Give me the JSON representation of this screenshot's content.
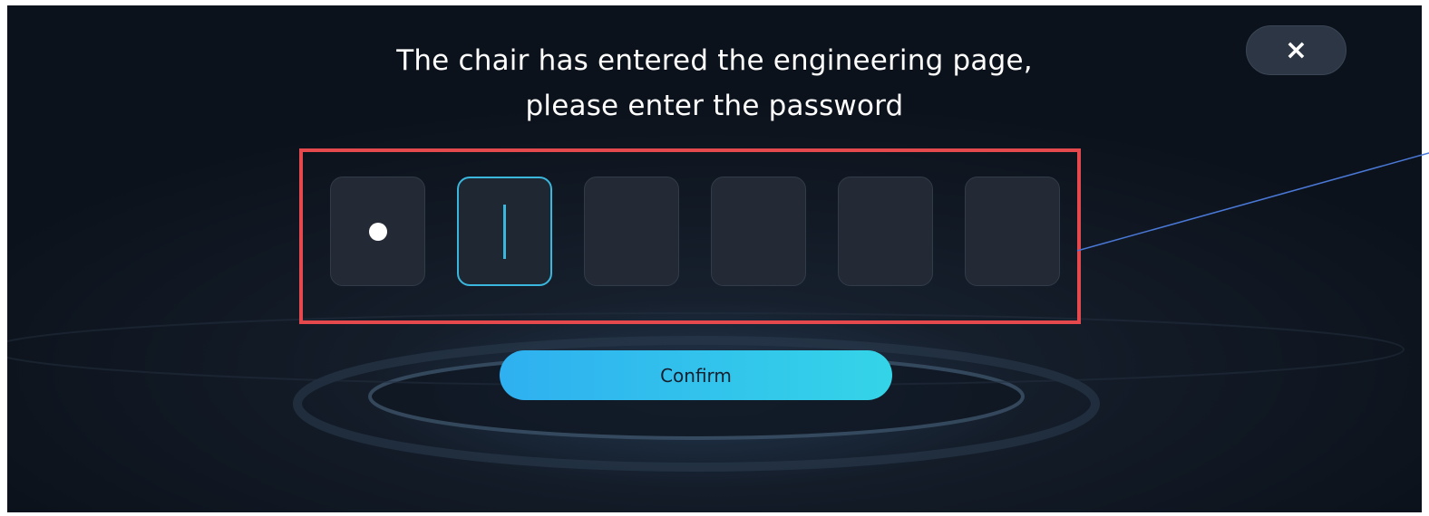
{
  "dialog": {
    "title_line1": "The chair has entered the engineering page,",
    "title_line2": "please enter the password",
    "close_label": "×",
    "confirm_label": "Confirm"
  },
  "password": {
    "length": 6,
    "filled_count": 1,
    "active_index": 1
  },
  "icons": {
    "close": "close-icon",
    "filled": "dot-icon",
    "caret": "text-caret"
  },
  "colors": {
    "accent": "#3bb6dc",
    "highlight": "#e5484d",
    "callout": "#4a78d6",
    "confirm_start": "#2fb0f0",
    "confirm_end": "#34d4e8"
  }
}
